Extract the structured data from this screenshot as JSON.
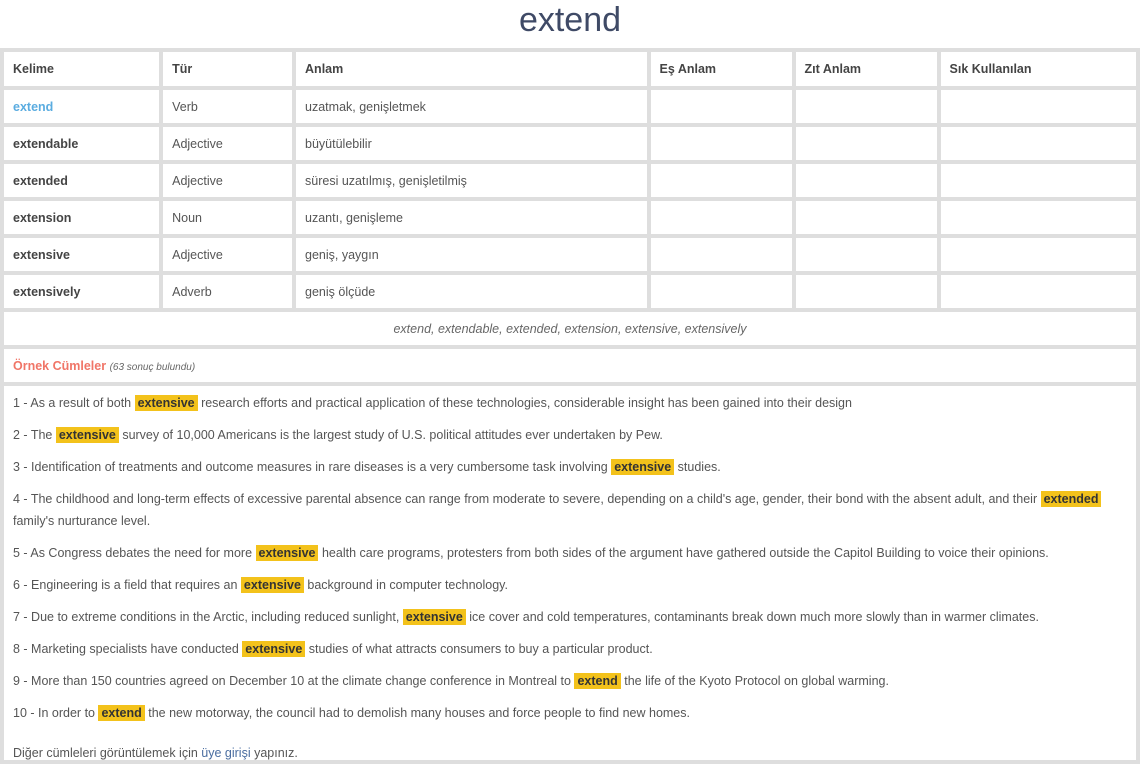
{
  "page": {
    "title": "extend"
  },
  "table": {
    "headers": [
      "Kelime",
      "Tür",
      "Anlam",
      "Eş Anlam",
      "Zıt Anlam",
      "Sık Kullanılan"
    ],
    "rows": [
      {
        "word": "extend",
        "type": "Verb",
        "meaning": "uzatmak, genişletmek",
        "synonym": "",
        "antonym": "",
        "frequent": "",
        "current": true
      },
      {
        "word": "extendable",
        "type": "Adjective",
        "meaning": "büyütülebilir",
        "synonym": "",
        "antonym": "",
        "frequent": ""
      },
      {
        "word": "extended",
        "type": "Adjective",
        "meaning": "süresi uzatılmış, genişletilmiş",
        "synonym": "",
        "antonym": "",
        "frequent": ""
      },
      {
        "word": "extension",
        "type": "Noun",
        "meaning": "uzantı, genişleme",
        "synonym": "",
        "antonym": "",
        "frequent": ""
      },
      {
        "word": "extensive",
        "type": "Adjective",
        "meaning": "geniş, yaygın",
        "synonym": "",
        "antonym": "",
        "frequent": ""
      },
      {
        "word": "extensively",
        "type": "Adverb",
        "meaning": "geniş ölçüde",
        "synonym": "",
        "antonym": "",
        "frequent": ""
      }
    ],
    "word_forms": "extend, extendable, extended, extension, extensive, extensively"
  },
  "examples": {
    "title": "Örnek Cümleler",
    "count_text": "(63 sonuç bulundu)",
    "highlight_color": "#f3c21b",
    "sentences": [
      {
        "prefix": "1 - As a result of both ",
        "keyword": "extensive",
        "suffix": " research efforts and practical application of these technologies, considerable insight has been gained into their design"
      },
      {
        "prefix": "2 - The ",
        "keyword": "extensive",
        "suffix": " survey of 10,000 Americans is the largest study of U.S. political attitudes ever undertaken by Pew."
      },
      {
        "prefix": "3 - Identification of treatments and outcome measures in rare diseases is a very cumbersome task involving ",
        "keyword": "extensive",
        "suffix": " studies."
      },
      {
        "prefix": "4 - The childhood and long-term effects of excessive parental absence can range from moderate to severe, depending on a child's age, gender, their bond with the absent adult, and their ",
        "keyword": "extended",
        "suffix": " family's nurturance level."
      },
      {
        "prefix": "5 - As Congress debates the need for more ",
        "keyword": "extensive",
        "suffix": " health care programs, protesters from both sides of the argument have gathered outside the Capitol Building to voice their opinions."
      },
      {
        "prefix": "6 - Engineering is a field that requires an ",
        "keyword": "extensive",
        "suffix": " background in computer technology."
      },
      {
        "prefix": "7 - Due to extreme conditions in the Arctic, including reduced sunlight, ",
        "keyword": "extensive",
        "suffix": " ice cover and cold temperatures, contaminants break down much more slowly than in warmer climates."
      },
      {
        "prefix": "8 - Marketing specialists have conducted ",
        "keyword": "extensive",
        "suffix": " studies of what attracts consumers to buy a particular product."
      },
      {
        "prefix": "9 - More than 150 countries agreed on December 10 at the climate change conference in Montreal to ",
        "keyword": "extend",
        "suffix": " the life of the Kyoto Protocol on global warming."
      },
      {
        "prefix": "10 - In order to ",
        "keyword": "extend",
        "suffix": " the new motorway, the council had to demolish many houses and force people to find new homes."
      }
    ],
    "login_note": {
      "before": "Diğer cümleleri görüntülemek için ",
      "link": "üye girişi",
      "after": " yapınız."
    }
  }
}
